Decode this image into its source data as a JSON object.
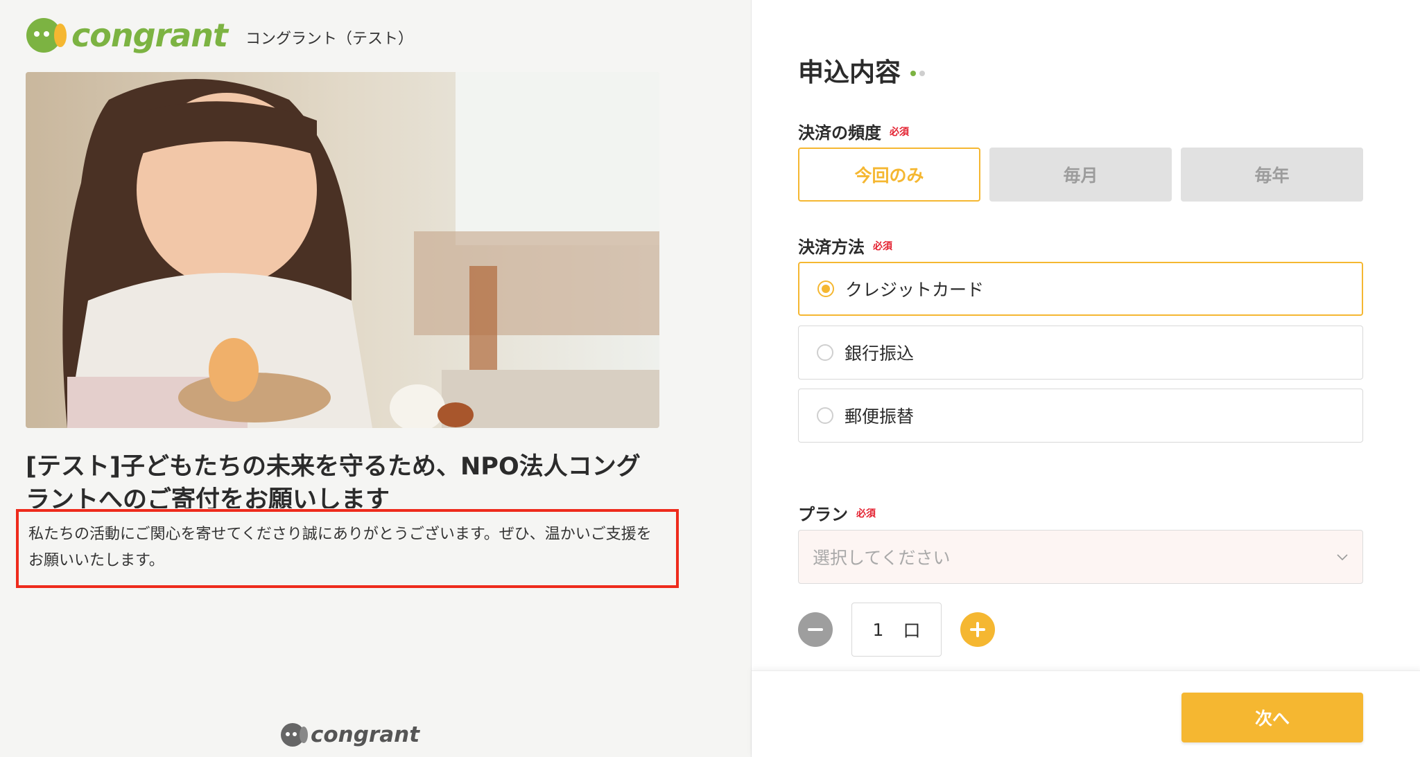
{
  "brand": {
    "logo_text": "congrant",
    "org_name": "コングラント（テスト）"
  },
  "campaign": {
    "title": "[テスト]子どもたちの未来を守るため、NPO法人コングラントへのご寄付をお願いします",
    "description": "私たちの活動にご関心を寄せてくださり誠にありがとうございます。ぜひ、温かいご支援をお願いいたします。"
  },
  "footer": {
    "logo_text": "congrant"
  },
  "form": {
    "section_title": "申込内容",
    "frequency": {
      "label": "決済の頻度",
      "required": "必須",
      "options": [
        "今回のみ",
        "毎月",
        "毎年"
      ],
      "selected": 0
    },
    "method": {
      "label": "決済方法",
      "required": "必須",
      "options": [
        "クレジットカード",
        "銀行振込",
        "郵便振替"
      ],
      "selected": 0
    },
    "plan": {
      "label": "プラン",
      "required": "必須",
      "placeholder": "選択してください"
    },
    "quantity": {
      "value": "1",
      "unit": "口"
    },
    "next_label": "次へ"
  },
  "colors": {
    "accent": "#f5b731",
    "brand_green": "#7cb342",
    "required_red": "#e3202f",
    "highlight_red": "#ee2b1c"
  }
}
